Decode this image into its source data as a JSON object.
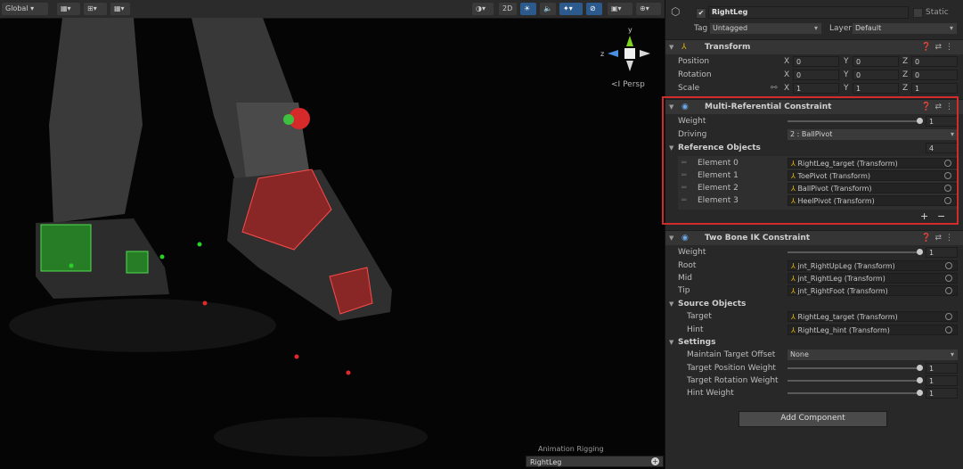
{
  "toolbar": {
    "global_label": "Global",
    "twod_label": "2D"
  },
  "scene": {
    "persp_label": "Persp",
    "gizmo_y": "y",
    "gizmo_z": "z"
  },
  "overlay": {
    "title": "Animation Rigging",
    "field_value": "RightLeg",
    "plus": "+"
  },
  "inspector": {
    "object_name": "RightLeg",
    "static_label": "Static",
    "tag_label": "Tag",
    "tag_value": "Untagged",
    "layer_label": "Layer",
    "layer_value": "Default",
    "transform": {
      "title": "Transform",
      "position_label": "Position",
      "rotation_label": "Rotation",
      "scale_label": "Scale",
      "x_label": "X",
      "y_label": "Y",
      "z_label": "Z",
      "position": [
        "0",
        "0",
        "0"
      ],
      "rotation": [
        "0",
        "0",
        "0"
      ],
      "scale": [
        "1",
        "1",
        "1"
      ]
    },
    "multi_ref": {
      "title": "Multi-Referential Constraint",
      "weight_label": "Weight",
      "weight_value": "1",
      "driving_label": "Driving",
      "driving_value": "2 : BallPivot",
      "ref_label": "Reference Objects",
      "ref_count": "4",
      "elements": [
        {
          "label": "Element 0",
          "value": "RightLeg_target (Transform)"
        },
        {
          "label": "Element 1",
          "value": "ToePivot (Transform)"
        },
        {
          "label": "Element 2",
          "value": "BallPivot (Transform)"
        },
        {
          "label": "Element 3",
          "value": "HeelPivot (Transform)"
        }
      ],
      "plus": "+",
      "minus": "−"
    },
    "two_bone": {
      "title": "Two Bone IK Constraint",
      "weight_label": "Weight",
      "weight_value": "1",
      "root_label": "Root",
      "root_value": "jnt_RightUpLeg (Transform)",
      "mid_label": "Mid",
      "mid_value": "jnt_RightLeg (Transform)",
      "tip_label": "Tip",
      "tip_value": "jnt_RightFoot (Transform)",
      "source_label": "Source Objects",
      "target_label": "Target",
      "target_value": "RightLeg_target (Transform)",
      "hint_label": "Hint",
      "hint_value": "RightLeg_hint (Transform)",
      "settings_label": "Settings",
      "mto_label": "Maintain Target Offset",
      "mto_value": "None",
      "tpw_label": "Target Position Weight",
      "tpw_value": "1",
      "trw_label": "Target Rotation Weight",
      "trw_value": "1",
      "hw_label": "Hint Weight",
      "hw_value": "1"
    },
    "add_component": "Add Component"
  },
  "colors": {
    "highlight": "#d22b2b",
    "accent": "#2d5a8c"
  }
}
